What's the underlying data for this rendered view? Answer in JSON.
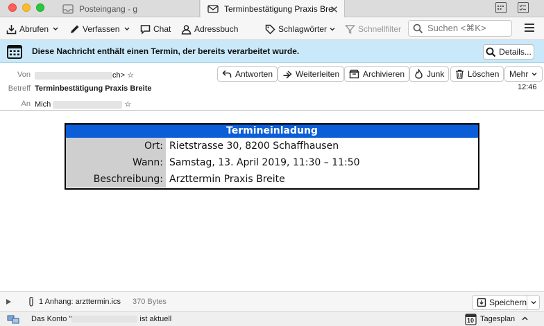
{
  "tabs": [
    {
      "label": "Posteingang - g",
      "icon": "inbox-icon",
      "active": false
    },
    {
      "label": "Terminbestätigung Praxis Bre",
      "icon": "envelope-icon",
      "active": true
    }
  ],
  "toolbar": {
    "fetch_label": "Abrufen",
    "compose_label": "Verfassen",
    "chat_label": "Chat",
    "addressbook_label": "Adressbuch",
    "tags_label": "Schlagwörter",
    "quickfilter_label": "Schnellfilter",
    "search_placeholder": "Suchen <⌘K>"
  },
  "notification": {
    "text": "Diese Nachricht enthält einen Termin, der bereits verarbeitet wurde.",
    "details_label": "Details..."
  },
  "header": {
    "from_label": "Von",
    "from_suffix": "ch>",
    "subject_label": "Betreff",
    "subject": "Terminbestätigung Praxis Breite",
    "to_label": "An",
    "to_value": "Mich",
    "time": "12:46",
    "actions": {
      "reply": "Antworten",
      "forward": "Weiterleiten",
      "archive": "Archivieren",
      "junk": "Junk",
      "delete": "Löschen",
      "more": "Mehr"
    }
  },
  "invitation": {
    "title": "Termineinladung",
    "rows": [
      {
        "key": "Ort:",
        "value": "Rietstrasse 30, 8200 Schaffhausen"
      },
      {
        "key": "Wann:",
        "value": "Samstag, 13. April 2019, 11:30 – 11:50"
      },
      {
        "key": "Beschreibung:",
        "value": "Arzttermin Praxis Breite"
      }
    ]
  },
  "attachment": {
    "text": "1 Anhang: arzttermin.ics",
    "size": "370 Bytes",
    "save_label": "Speichern"
  },
  "status": {
    "text_prefix": "Das Konto \"",
    "text_suffix": "ist aktuell",
    "calendar_day": "10",
    "today_pane_label": "Tagesplan"
  },
  "colors": {
    "notification_bg": "#c9e9fb",
    "invitation_header": "#0b5ed7",
    "close": "#fe5f57",
    "minimize": "#febc2e",
    "maximize": "#28c840"
  }
}
